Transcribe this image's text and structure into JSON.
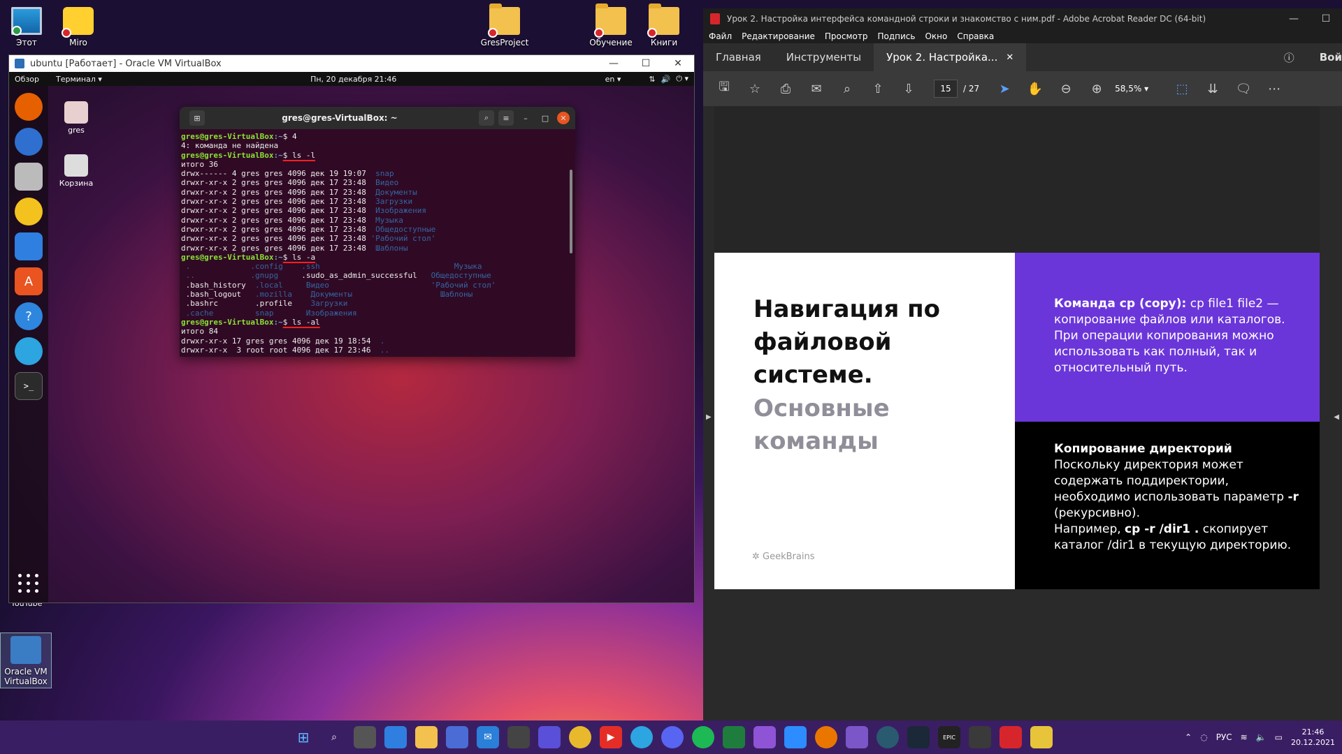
{
  "desktop": {
    "icons_top": [
      {
        "label": "Этот",
        "status": "ok"
      },
      {
        "label": "Miro",
        "status": "error"
      },
      {
        "label": "GresProject",
        "status": "error"
      },
      {
        "label": "Обучение",
        "status": "error"
      },
      {
        "label": "Книги",
        "status": "error"
      }
    ],
    "virtualbox_shortcut": "Oracle VM VirtualBox",
    "youtube_label": "YouTube"
  },
  "vbox": {
    "title": "ubuntu [Работает] - Oracle VM VirtualBox",
    "gnome": {
      "activities": "Обзор",
      "app_menu": "Терминал ▾",
      "datetime": "Пн, 20 декабря  21:46",
      "lang": "en ▾"
    },
    "desktop_icons": [
      {
        "label": "gres"
      },
      {
        "label": "Корзина"
      }
    ],
    "terminal": {
      "title": "gres@gres-VirtualBox: ~",
      "prompt_user": "gres@gres-VirtualBox",
      "prompt_path": ":~",
      "lines": [
        {
          "type": "cmd",
          "cmd": "$ 4"
        },
        {
          "type": "out",
          "text": "4: команда не найдена"
        },
        {
          "type": "cmd",
          "cmd": "$ ls -l",
          "ul": true
        },
        {
          "type": "out",
          "text": "итого 36"
        },
        {
          "type": "ls",
          "perm": "drwx------ 4 gres gres 4096 дек 19 19:07  ",
          "name": "snap"
        },
        {
          "type": "ls",
          "perm": "drwxr-xr-x 2 gres gres 4096 дек 17 23:48  ",
          "name": "Видео"
        },
        {
          "type": "ls",
          "perm": "drwxr-xr-x 2 gres gres 4096 дек 17 23:48  ",
          "name": "Документы"
        },
        {
          "type": "ls",
          "perm": "drwxr-xr-x 2 gres gres 4096 дек 17 23:48  ",
          "name": "Загрузки"
        },
        {
          "type": "ls",
          "perm": "drwxr-xr-x 2 gres gres 4096 дек 17 23:48  ",
          "name": "Изображения"
        },
        {
          "type": "ls",
          "perm": "drwxr-xr-x 2 gres gres 4096 дек 17 23:48  ",
          "name": "Музыка"
        },
        {
          "type": "ls",
          "perm": "drwxr-xr-x 2 gres gres 4096 дек 17 23:48  ",
          "name": "Общедоступные"
        },
        {
          "type": "ls",
          "perm": "drwxr-xr-x 2 gres gres 4096 дек 17 23:48 ",
          "name": "'Рабочий стол'"
        },
        {
          "type": "ls",
          "perm": "drwxr-xr-x 2 gres gres 4096 дек 17 23:48  ",
          "name": "Шаблоны"
        },
        {
          "type": "cmd",
          "cmd": "$ ls -a",
          "ul": true
        },
        {
          "type": "cols",
          "cells": [
            [
              " .",
              true
            ],
            [
              "             .config",
              true
            ],
            [
              "    .ssh",
              true
            ],
            [
              "                             Музыка",
              true
            ]
          ]
        },
        {
          "type": "cols",
          "cells": [
            [
              " ..",
              true
            ],
            [
              "            .gnupg",
              true
            ],
            [
              "     ",
              false
            ],
            [
              ".sudo_as_admin_successful",
              false
            ],
            [
              "   Общедоступные",
              true
            ]
          ]
        },
        {
          "type": "cols",
          "cells": [
            [
              " .bash_history",
              false
            ],
            [
              "  .local",
              true
            ],
            [
              "     Видео",
              true
            ],
            [
              "                      'Рабочий стол'",
              true
            ]
          ]
        },
        {
          "type": "cols",
          "cells": [
            [
              " .bash_logout",
              false
            ],
            [
              "   .mozilla",
              true
            ],
            [
              "    Документы",
              true
            ],
            [
              "                   Шаблоны",
              true
            ]
          ]
        },
        {
          "type": "cols",
          "cells": [
            [
              " .bashrc",
              false
            ],
            [
              "        .profile",
              false
            ],
            [
              "    Загрузки",
              true
            ]
          ]
        },
        {
          "type": "cols",
          "cells": [
            [
              " .cache",
              true
            ],
            [
              "         snap",
              true
            ],
            [
              "       Изображения",
              true
            ]
          ]
        },
        {
          "type": "cmd",
          "cmd": "$ ls -al",
          "ul": true
        },
        {
          "type": "out",
          "text": "итого 84"
        },
        {
          "type": "ls",
          "perm": "drwxr-xr-x 17 gres gres 4096 дек 19 18:54  ",
          "name": "."
        },
        {
          "type": "ls",
          "perm": "drwxr-xr-x  3 root root 4096 дек 17 23:46  ",
          "name": ".."
        }
      ]
    }
  },
  "acrobat": {
    "title": "Урок 2. Настройка интерфейса командной строки и знакомство с ним.pdf - Adobe Acrobat Reader DC (64-bit)",
    "menu": [
      "Файл",
      "Редактирование",
      "Просмотр",
      "Подпись",
      "Окно",
      "Справка"
    ],
    "tabs": {
      "home": "Главная",
      "tools": "Инструменты",
      "doc": "Урок 2. Настройка...",
      "signin": "Вой"
    },
    "page_current": "15",
    "page_total": "/  27",
    "zoom": "58,5%",
    "slide": {
      "title": "Навигация по файловой системе.",
      "subtitle": "Основные команды",
      "logo": "GeekBrains",
      "purple": {
        "bold": "Команда cp (copy):",
        "text1": " cp file1 file2  — копирование файлов или каталогов. При операции копирования можно использовать как полный, так и относительный путь."
      },
      "black": {
        "heading": "Копирование директорий",
        "text1": "Поскольку директория может содержать поддиректории, необходимо использовать параметр ",
        "flag": "-r",
        "text2": " (рекурсивно).",
        "text3": "Например, ",
        "example": "cp -r /dir1 .",
        "text4": " скопирует каталог /dir1 в текущую директорию."
      }
    }
  },
  "taskbar": {
    "lang": "РУС",
    "time": "21:46",
    "date": "20.12.2021"
  },
  "colors": {
    "slide_purple": "#6b36d9",
    "terminal_bg": "#300a24",
    "prompt_green": "#8ae234",
    "prompt_blue": "#729fcf",
    "taskbar": "#3a1e63"
  }
}
